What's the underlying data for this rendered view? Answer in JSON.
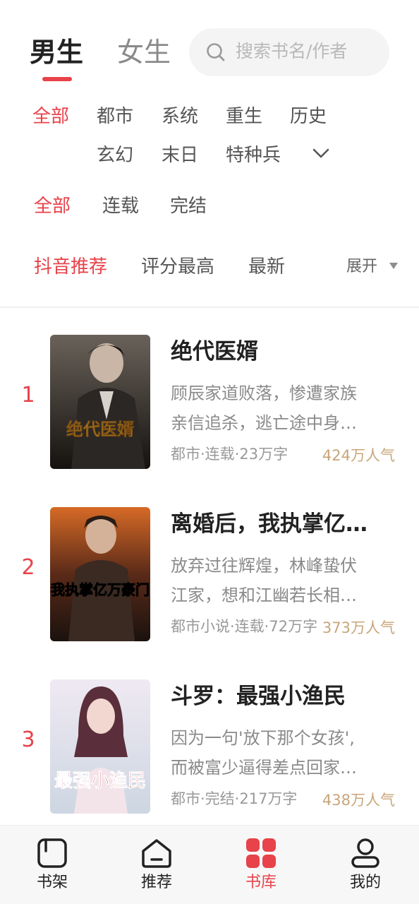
{
  "header": {
    "gender_tabs": [
      "男生",
      "女生"
    ],
    "active_gender": "男生",
    "search_placeholder": "搜索书名/作者"
  },
  "categories": [
    "全部",
    "都市",
    "系统",
    "重生",
    "历史",
    "玄幻",
    "末日",
    "特种兵"
  ],
  "active_category": "全部",
  "status_filters": [
    "全部",
    "连载",
    "完结"
  ],
  "active_status": "全部",
  "sort_options": [
    "抖音推荐",
    "评分最高",
    "最新"
  ],
  "active_sort": "抖音推荐",
  "sort_expand_label": "展开",
  "books": [
    {
      "rank": "1",
      "title": "绝代医婿",
      "desc_line1": "顾辰家道败落，惨遭家族",
      "desc_line2": "亲信追杀，逃亡途中身…",
      "meta": "都市·连载·23万字",
      "popularity": "424万人气",
      "cover_text": "绝代医婿",
      "cover_colors": [
        "#5b5148",
        "#1f1b18"
      ]
    },
    {
      "rank": "2",
      "title": "离婚后，我执掌亿…",
      "desc_line1": "放弃过往辉煌，林峰蛰伏",
      "desc_line2": "江家，想和江幽若长相…",
      "meta": "都市小说·连载·72万字",
      "popularity": "373万人气",
      "cover_text": "我执掌亿万豪门",
      "cover_colors": [
        "#c0541e",
        "#2a1a14"
      ]
    },
    {
      "rank": "3",
      "title": "斗罗：最强小渔民",
      "desc_line1": "因为一句'放下那个女孩',",
      "desc_line2": "而被富少逼得差点回家…",
      "meta": "都市·完结·217万字",
      "popularity": "438万人气",
      "cover_text": "最强小渔民",
      "cover_colors": [
        "#e9e4ee",
        "#cfd8e4"
      ]
    }
  ],
  "nav": [
    {
      "label": "书架",
      "icon": "bookshelf-icon"
    },
    {
      "label": "推荐",
      "icon": "recommend-icon"
    },
    {
      "label": "书库",
      "icon": "library-icon"
    },
    {
      "label": "我的",
      "icon": "profile-icon"
    }
  ],
  "active_nav": "书库",
  "colors": {
    "accent": "#e8424a",
    "popularity": "#c8a57a"
  }
}
